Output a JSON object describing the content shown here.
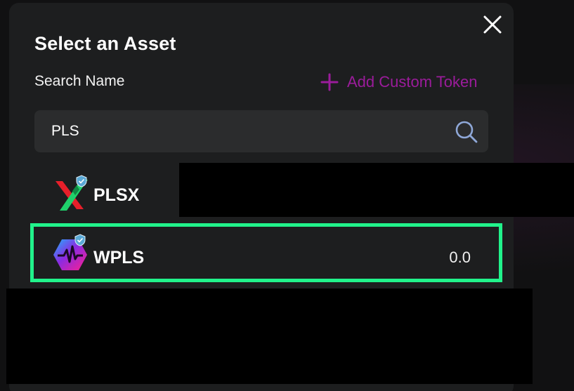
{
  "modal": {
    "title": "Select an Asset",
    "search_label": "Search Name",
    "add_custom_label": "Add Custom Token",
    "search": {
      "value": "PLS",
      "placeholder": ""
    }
  },
  "tokens": [
    {
      "symbol": "PLSX",
      "balance": "",
      "icon": "plsx-logo-icon",
      "verified": true
    },
    {
      "symbol": "WPLS",
      "balance": "0.0",
      "icon": "wpls-logo-icon",
      "verified": true,
      "highlighted": true
    }
  ],
  "colors": {
    "modal_bg": "#1d1e1f",
    "input_bg": "#2b2c2d",
    "accent_magenta": "#9b1c9b",
    "highlight_green": "#21f38b",
    "verified_badge": "#5aa9d6"
  },
  "icons": [
    "close-icon",
    "plus-icon",
    "search-icon",
    "verified-badge-icon"
  ]
}
